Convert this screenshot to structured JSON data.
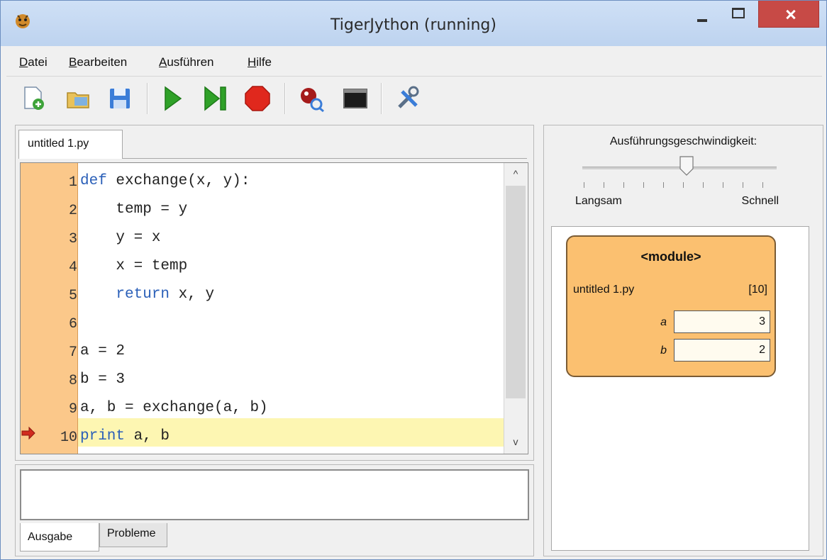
{
  "window": {
    "title": "TigerJython (running)"
  },
  "menu": [
    "Datei",
    "Bearbeiten",
    "Ausführen",
    "Hilfe"
  ],
  "toolbar": {
    "icons": [
      "new-file",
      "open-file",
      "save",
      "run",
      "step",
      "stop",
      "debugger",
      "console",
      "tools"
    ]
  },
  "editor": {
    "tab_label": "untitled 1.py",
    "line_numbers": [
      "1",
      "2",
      "3",
      "4",
      "5",
      "6",
      "7",
      "8",
      "9",
      "10"
    ],
    "lines": [
      {
        "kw": "def",
        "rest": " exchange(x, y):"
      },
      {
        "text": "    temp = y"
      },
      {
        "text": "    y = x"
      },
      {
        "text": "    x = temp"
      },
      {
        "kw": "    return",
        "rest": " x, y"
      },
      {
        "text": ""
      },
      {
        "text": "a = 2"
      },
      {
        "text": "b = 3"
      },
      {
        "text": "a, b = exchange(a, b)"
      },
      {
        "kw": "print",
        "rest": " a, b"
      }
    ],
    "current_line": "10"
  },
  "output": {
    "tabs": [
      "Ausgabe",
      "Probleme"
    ],
    "text": ""
  },
  "speed": {
    "label": "Ausführungsgeschwindigkeit:",
    "slow": "Langsam",
    "fast": "Schnell",
    "level": 0.5
  },
  "frame": {
    "title": "<module>",
    "file": "untitled 1.py",
    "line": "[10]",
    "variables": [
      {
        "name": "a",
        "value": "3"
      },
      {
        "name": "b",
        "value": "2"
      }
    ]
  }
}
